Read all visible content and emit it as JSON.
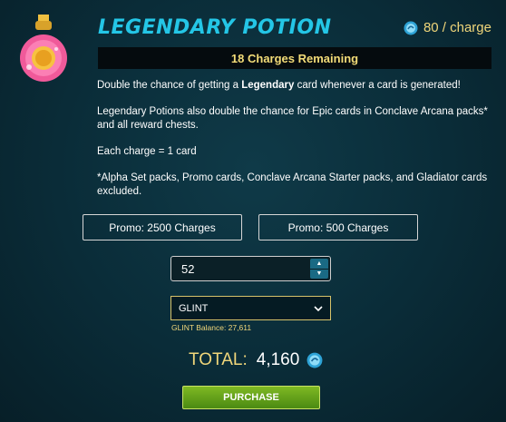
{
  "header": {
    "title": "LEGENDARY POTION",
    "price_label": "80 / charge",
    "potion_icon": "legendary-potion-icon",
    "price_icon": "dec-coin-icon"
  },
  "charges_remaining": "18 Charges Remaining",
  "description": {
    "line1_prefix": "Double the chance of getting a ",
    "line1_bold": "Legendary",
    "line1_suffix": " card whenever a card is generated!",
    "line2": "Legendary Potions also double the chance for Epic cards in Conclave Arcana packs* and all reward chests.",
    "line3": "Each charge = 1 card",
    "line4": "*Alpha Set packs, Promo cards, Conclave Arcana Starter packs, and Gladiator cards excluded."
  },
  "promo_buttons": [
    {
      "label": "Promo: 2500 Charges"
    },
    {
      "label": "Promo: 500 Charges"
    }
  ],
  "quantity": {
    "value": "52"
  },
  "currency_select": {
    "selected": "GLINT"
  },
  "balance": "GLINT Balance: 27,611",
  "total": {
    "label": "TOTAL:",
    "value": "4,160",
    "icon": "dec-coin-icon"
  },
  "purchase_label": "PURCHASE",
  "colors": {
    "title": "#24c6e6",
    "accent_gold": "#f0d67a",
    "purchase_green": "#6aa81e"
  }
}
